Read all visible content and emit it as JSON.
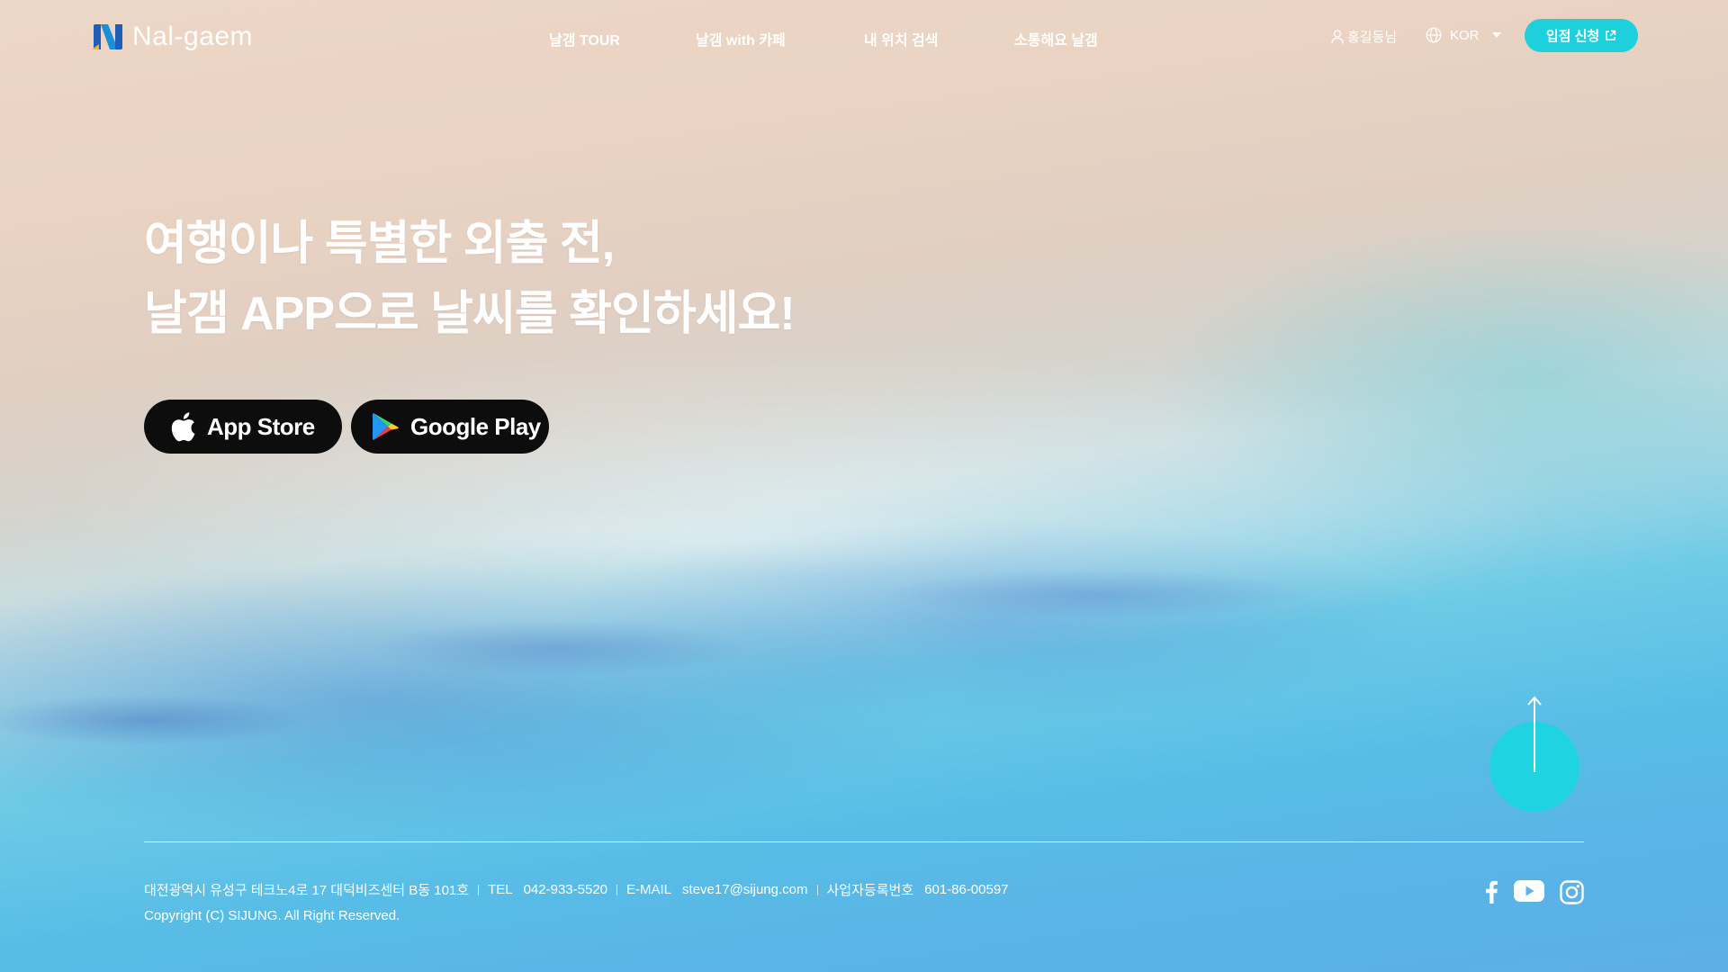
{
  "brand": {
    "name": "Nal-gaem"
  },
  "nav": {
    "items": [
      "날갬 TOUR",
      "날갬 with 카페",
      "내 위치 검색",
      "소통해요 날갬"
    ]
  },
  "header": {
    "user_label": "홍길동님",
    "language": "KOR",
    "apply_label": "입점 신청"
  },
  "hero": {
    "line1": "여행이나 특별한 외출 전,",
    "line2": "날갬 APP으로 날씨를 확인하세요!"
  },
  "stores": {
    "app_store": "App Store",
    "google_play": "Google Play"
  },
  "footer": {
    "address": "대전광역시 유성구 테크노4로 17 대덕비즈센터 B동 101호",
    "tel_label": "TEL",
    "tel": "042-933-5520",
    "email_label": "E-MAIL",
    "email": "steve17@sijung.com",
    "biz_label": "사업자등록번호",
    "biz_no": "601-86-00597",
    "copyright": "Copyright (C) SIJUNG. All Right Reserved."
  },
  "colors": {
    "accent": "#1ed0dc",
    "store_button": "#0d0d0d"
  },
  "icons": [
    "logo-icon",
    "user-icon",
    "globe-icon",
    "chevron-down-icon",
    "external-link-icon",
    "apple-icon",
    "google-play-icon",
    "arrow-up-icon",
    "facebook-icon",
    "youtube-icon",
    "instagram-icon"
  ]
}
